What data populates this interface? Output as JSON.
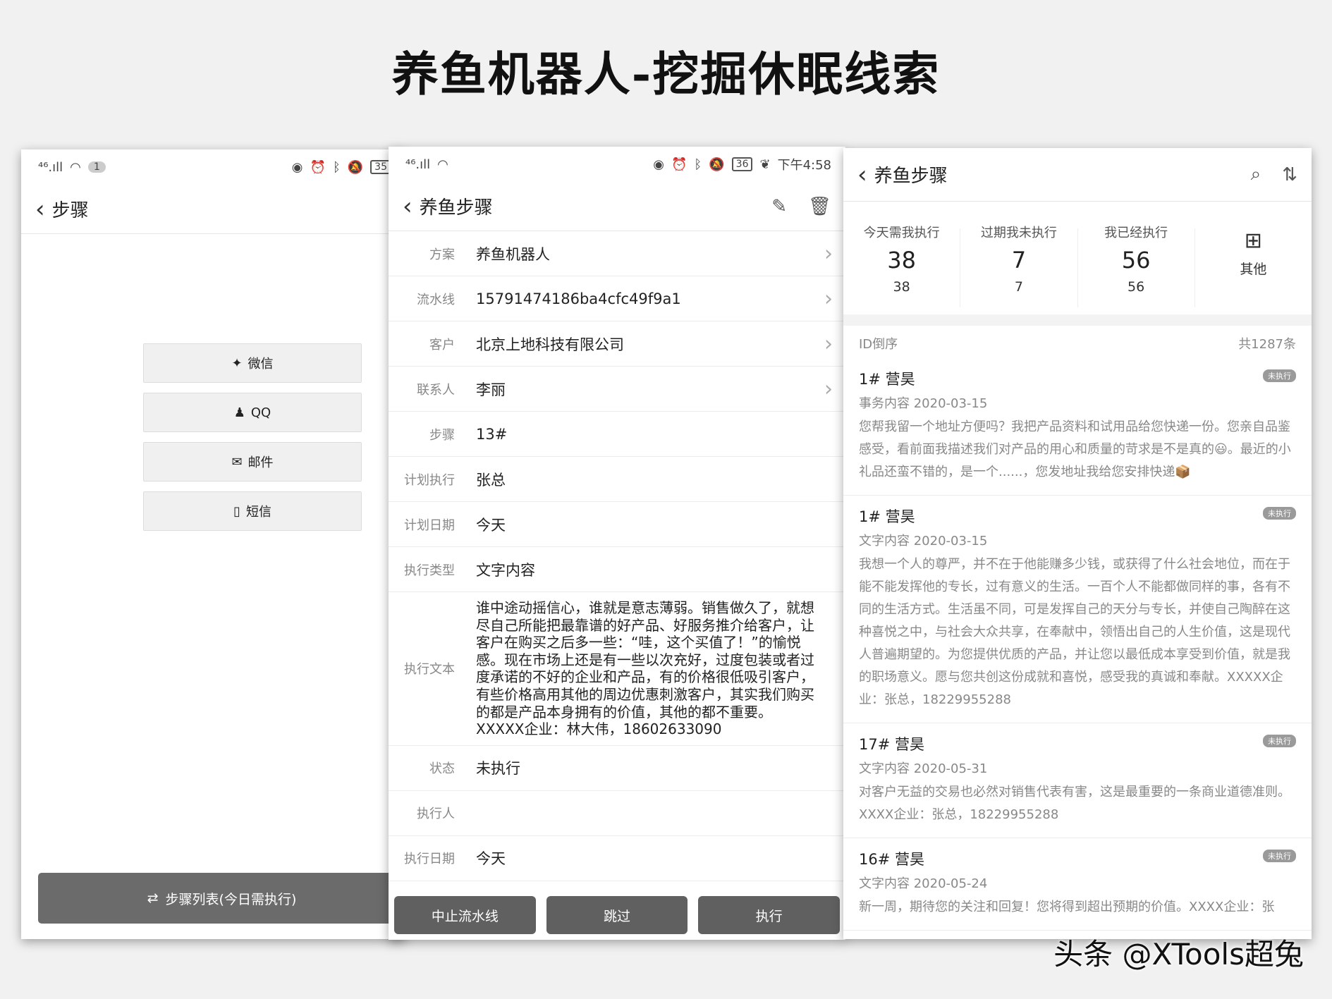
{
  "page_title": "养鱼机器人-挖掘休眠线索",
  "watermark": "头条 @XTools超兔",
  "screen1": {
    "status": {
      "net": "⁴⁶.ıll",
      "notif_count": "1",
      "battery": "35"
    },
    "header_title": "步骤",
    "share_buttons": [
      {
        "icon": "wechat-icon",
        "glyph": "✦",
        "label": "微信"
      },
      {
        "icon": "qq-icon",
        "glyph": "♟",
        "label": "QQ"
      },
      {
        "icon": "mail-icon",
        "glyph": "✉",
        "label": "邮件"
      },
      {
        "icon": "phone-icon",
        "glyph": "▯",
        "label": "短信"
      }
    ],
    "bottom_button": "步骤列表(今日需执行)"
  },
  "screen2": {
    "status": {
      "net": "⁴⁶.ıll",
      "battery": "36",
      "time": "下午4:58"
    },
    "header_title": "养鱼步骤",
    "rows": {
      "plan": {
        "label": "方案",
        "value": "养鱼机器人"
      },
      "pipeline": {
        "label": "流水线",
        "value": "15791474186ba4cfc49f9a1"
      },
      "customer": {
        "label": "客户",
        "value": "北京上地科技有限公司"
      },
      "contact": {
        "label": "联系人",
        "value": "李丽"
      },
      "step": {
        "label": "步骤",
        "value": "13#"
      },
      "planned_exec": {
        "label": "计划执行",
        "value": "张总"
      },
      "planned_date": {
        "label": "计划日期",
        "value": "今天"
      },
      "exec_type": {
        "label": "执行类型",
        "value": "文字内容"
      },
      "exec_text": {
        "label": "执行文本",
        "value": "谁中途动摇信心，谁就是意志薄弱。销售做久了，就想尽自己所能把最靠谱的好产品、好服务推介给客户，让客户在购买之后多一些：“哇，这个买值了！”的愉悦感。现在市场上还是有一些以次充好，过度包装或者过度承诺的不好的企业和产品，有的价格很低吸引客户，有些价格高用其他的周边优惠刺激客户，其实我们购买的都是产品本身拥有的价值，其他的都不重要。XXXXX企业：林大伟，18602633090"
      },
      "status": {
        "label": "状态",
        "value": "未执行"
      },
      "executor": {
        "label": "执行人",
        "value": ""
      },
      "exec_date": {
        "label": "执行日期",
        "value": "今天"
      }
    },
    "actions": {
      "stop": "中止流水线",
      "skip": "跳过",
      "execute": "执行"
    }
  },
  "screen3": {
    "header_title": "养鱼步骤",
    "stats": [
      {
        "label": "今天需我执行",
        "value": "38",
        "sub": "38"
      },
      {
        "label": "过期我未执行",
        "value": "7",
        "sub": "7"
      },
      {
        "label": "我已经执行",
        "value": "56",
        "sub": "56"
      }
    ],
    "other_label": "其他",
    "sort_label": "ID倒序",
    "total_label": "共1287条",
    "items": [
      {
        "title": "1# 营昊",
        "badge": "未执行",
        "sub": "事务内容 2020-03-15",
        "body": "您帮我留一个地址方便吗？我把产品资料和试用品给您快递一份。您亲自品鉴感受，看前面我描述我们对产品的用心和质量的苛求是不是真的😃。最近的小礼品还蛮不错的，是一个......，您发地址我给您安排快递📦"
      },
      {
        "title": "1# 营昊",
        "badge": "未执行",
        "sub": "文字内容 2020-03-15",
        "body": "我想一个人的尊严，并不在于他能赚多少钱，或获得了什么社会地位，而在于能不能发挥他的专长，过有意义的生活。一百个人不能都做同样的事，各有不同的生活方式。生活虽不同，可是发挥自己的天分与专长，并使自己陶醉在这种喜悦之中，与社会大众共享，在奉献中，领悟出自己的人生价值，这是现代人普遍期望的。为您提供优质的产品，并让您以最低成本享受到价值，就是我的职场意义。愿与您共创这份成就和喜悦，感受我的真诚和奉献。XXXXX企业：张总，18229955288"
      },
      {
        "title": "17# 营昊",
        "badge": "未执行",
        "sub": "文字内容 2020-05-31",
        "body": "对客户无益的交易也必然对销售代表有害，这是最重要的一条商业道德准则。XXXX企业：张总，18229955288"
      },
      {
        "title": "16# 营昊",
        "badge": "未执行",
        "sub": "文字内容 2020-05-24",
        "body": "新一周，期待您的关注和回复！您将得到超出预期的价值。XXXX企业：张"
      }
    ]
  }
}
